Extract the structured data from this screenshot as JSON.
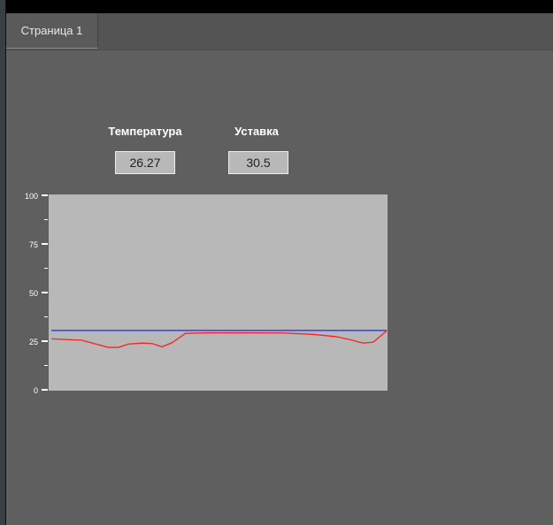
{
  "tabs": [
    {
      "label": "Страница 1",
      "active": true
    }
  ],
  "temperature": {
    "label": "Температура",
    "value": "26.27"
  },
  "setpoint": {
    "label": "Уставка",
    "value": "30.5"
  },
  "chart_data": {
    "type": "line",
    "ylim": [
      0,
      100
    ],
    "xlim": [
      0,
      100
    ],
    "yticks": [
      "0",
      "25",
      "50",
      "75",
      "100"
    ],
    "series": [
      {
        "name": "Уставка",
        "color": "#2020ff",
        "x": [
          0,
          100
        ],
        "y": [
          30.5,
          30.5
        ]
      },
      {
        "name": "Температура",
        "color": "#ff2020",
        "x": [
          0,
          9,
          17,
          20,
          23,
          27,
          30,
          33,
          36,
          40,
          47,
          69,
          78,
          85,
          89,
          93,
          96,
          100
        ],
        "y": [
          26.2,
          25.5,
          21.8,
          21.8,
          23.5,
          24,
          23.8,
          22.1,
          24.2,
          29,
          29.3,
          29.2,
          28.5,
          27.3,
          25.8,
          24,
          24.5,
          30.3
        ]
      }
    ]
  }
}
